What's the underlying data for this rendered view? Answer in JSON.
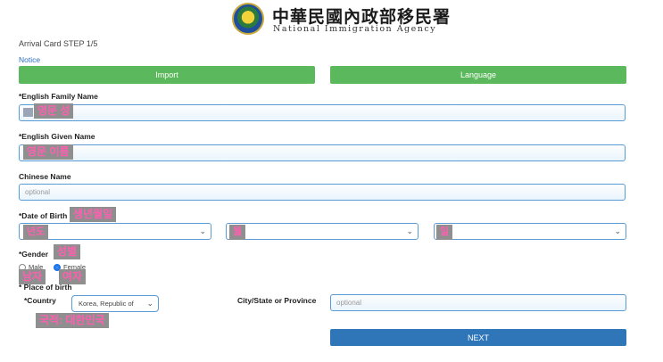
{
  "header": {
    "agency_zh": "中華民國內政部移民署",
    "agency_en": "National Immigration Agency",
    "emblem_icon": "nia-emblem-icon"
  },
  "step_title": "Arrival Card STEP 1/5",
  "notice_link": "Notice",
  "buttons": {
    "import": "Import",
    "language": "Language",
    "next": "NEXT"
  },
  "fields": {
    "family_name": {
      "label": "*English Family Name",
      "annotation": "영문 성"
    },
    "given_name": {
      "label": "*English Given Name",
      "annotation": "영문 이름"
    },
    "chinese_name": {
      "label": "Chinese Name",
      "placeholder": "optional"
    },
    "dob": {
      "label": "*Date of Birth",
      "annotation": "생년월일",
      "year_annotation": "년도",
      "month_annotation": "월",
      "day_annotation": "일"
    },
    "gender": {
      "label": "*Gender",
      "annotation": "성별",
      "male": "Male",
      "female": "Female",
      "male_annotation": "남자",
      "female_annotation": "여자",
      "selected": "Female"
    },
    "place_of_birth": {
      "label": "* Place of birth"
    },
    "country": {
      "label": "*Country",
      "value": "Korea, Republic of",
      "annotation": "국적: 대한민국"
    },
    "city": {
      "label": "City/State or Province",
      "placeholder": "optional"
    }
  },
  "colors": {
    "green": "#5cb85c",
    "blue": "#2f76b9",
    "input_border": "#5b9bd5",
    "annotation_text": "#ff5fb0"
  }
}
